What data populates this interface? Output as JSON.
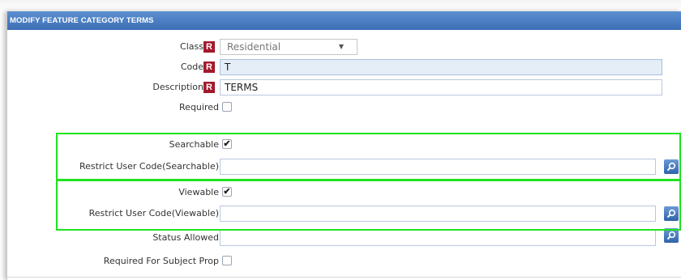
{
  "panel": {
    "title": "MODIFY FEATURE CATEGORY TERMS"
  },
  "required_marker": "R",
  "fields": {
    "class": {
      "label": "Class",
      "value": "Residential"
    },
    "code": {
      "label": "Code",
      "value": "T"
    },
    "description": {
      "label": "Description",
      "value": "TERMS"
    },
    "required": {
      "label": "Required",
      "checked": false
    },
    "searchable": {
      "label": "Searchable",
      "checked": true
    },
    "restrict_searchable": {
      "label": "Restrict User Code(Searchable)",
      "value": ""
    },
    "viewable": {
      "label": "Viewable",
      "checked": true
    },
    "restrict_viewable": {
      "label": "Restrict User Code(Viewable)",
      "value": ""
    },
    "status_allowed": {
      "label": "Status Allowed",
      "value": ""
    },
    "required_subject": {
      "label": "Required For Subject Prop",
      "checked": false
    }
  },
  "icons": {
    "lookup": "magnifier-icon",
    "check": "checkmark-icon",
    "caret": "caret-down-icon"
  },
  "colors": {
    "header": "#3d6fb5",
    "required_badge": "#a3192b",
    "highlight": "#1fe31f"
  }
}
